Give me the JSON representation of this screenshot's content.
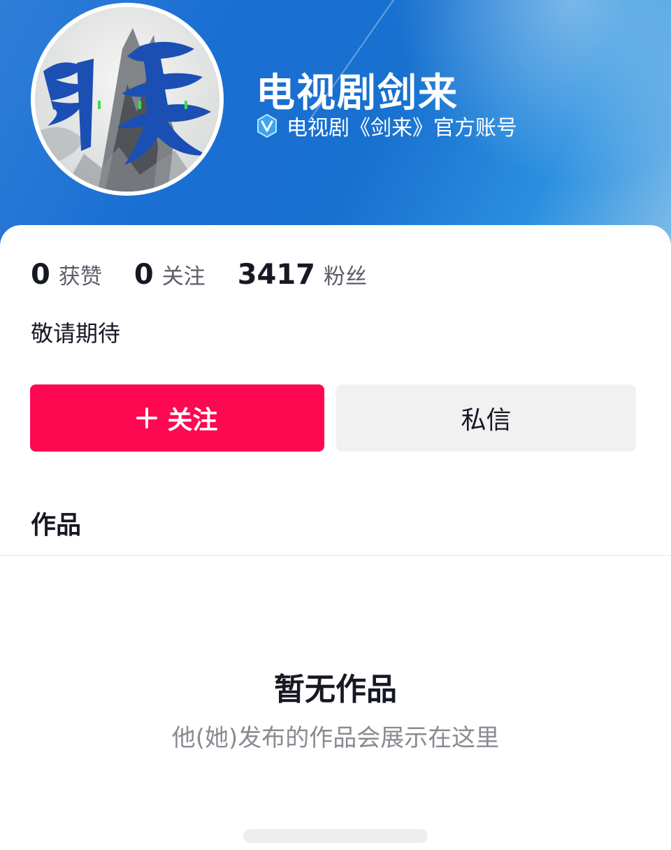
{
  "profile": {
    "name": "电视剧剑来",
    "verified_text": "电视剧《剑来》官方账号",
    "avatar_text": "剑来",
    "bio": "敬请期待"
  },
  "stats": [
    {
      "value": "0",
      "label": "获赞"
    },
    {
      "value": "0",
      "label": "关注"
    },
    {
      "value": "3417",
      "label": "粉丝"
    }
  ],
  "actions": {
    "follow_label": "关注",
    "message_label": "私信"
  },
  "tabs": {
    "works_label": "作品"
  },
  "empty_state": {
    "title": "暂无作品",
    "subtitle": "他(她)发布的作品会展示在这里"
  },
  "colors": {
    "follow_button": "#fe0852",
    "header_blue": "#1a6fd3",
    "message_button": "#f1f1f2"
  },
  "icons": {
    "verified": "verified-v-icon",
    "follow": "plus-icon"
  }
}
